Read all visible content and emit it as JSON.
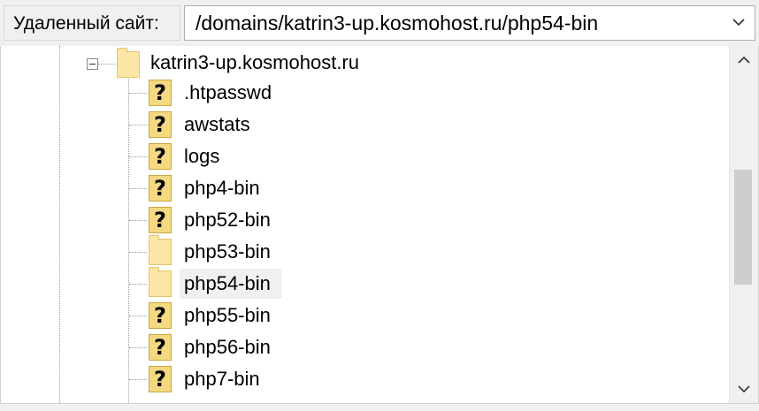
{
  "header": {
    "remote_label": "Удаленный сайт:",
    "path_value": "/domains/katrin3-up.kosmohost.ru/php54-bin"
  },
  "tree": {
    "root": {
      "label": "katrin3-up.kosmohost.ru",
      "expanded": true,
      "icon": "folder-icon"
    },
    "items": [
      {
        "label": ".htpasswd",
        "icon": "unknown-file-icon"
      },
      {
        "label": "awstats",
        "icon": "unknown-file-icon"
      },
      {
        "label": "logs",
        "icon": "unknown-file-icon"
      },
      {
        "label": "php4-bin",
        "icon": "unknown-file-icon"
      },
      {
        "label": "php52-bin",
        "icon": "unknown-file-icon"
      },
      {
        "label": "php53-bin",
        "icon": "folder-icon"
      },
      {
        "label": "php54-bin",
        "icon": "folder-icon",
        "selected": true
      },
      {
        "label": "php55-bin",
        "icon": "unknown-file-icon"
      },
      {
        "label": "php56-bin",
        "icon": "unknown-file-icon"
      },
      {
        "label": "php7-bin",
        "icon": "unknown-file-icon"
      }
    ],
    "unknown_glyph": "?"
  },
  "colors": {
    "folder": "#fbe6a5",
    "unknown_icon": "#f5d980",
    "selection": "#f0f0f0"
  }
}
